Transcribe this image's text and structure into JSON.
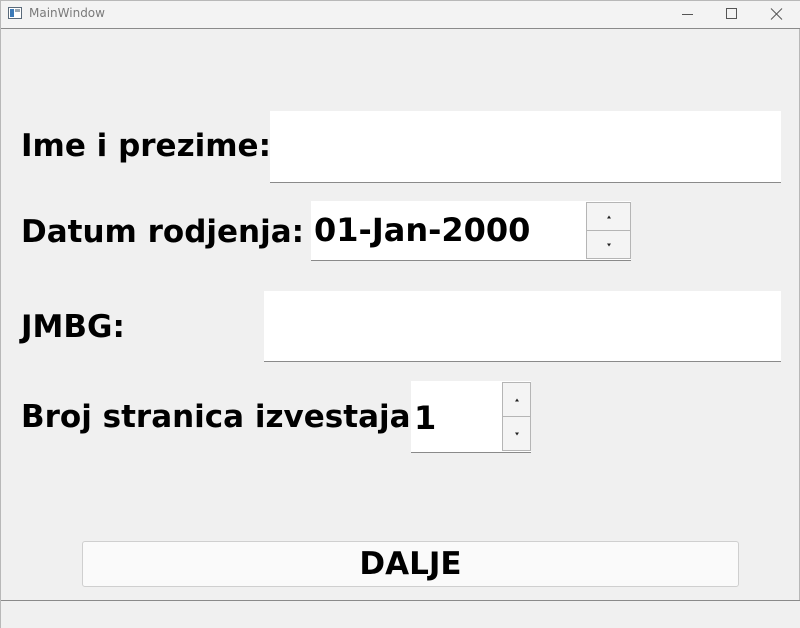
{
  "window": {
    "title": "MainWindow"
  },
  "form": {
    "name_label": "Ime i prezime:",
    "name_value": "",
    "birthdate_label": "Datum rodjenja:",
    "birthdate_value": "01-Jan-2000",
    "jmbg_label": "JMBG:",
    "jmbg_value": "",
    "pages_label": "Broj stranica izvestaja:",
    "pages_value": "1"
  },
  "actions": {
    "next_label": "DALJE"
  },
  "icons": {
    "app": "app-window-icon",
    "minimize": "minimize-icon",
    "maximize": "maximize-icon",
    "close": "close-icon",
    "spin_up": "arrow-up-icon",
    "spin_down": "arrow-down-icon"
  }
}
